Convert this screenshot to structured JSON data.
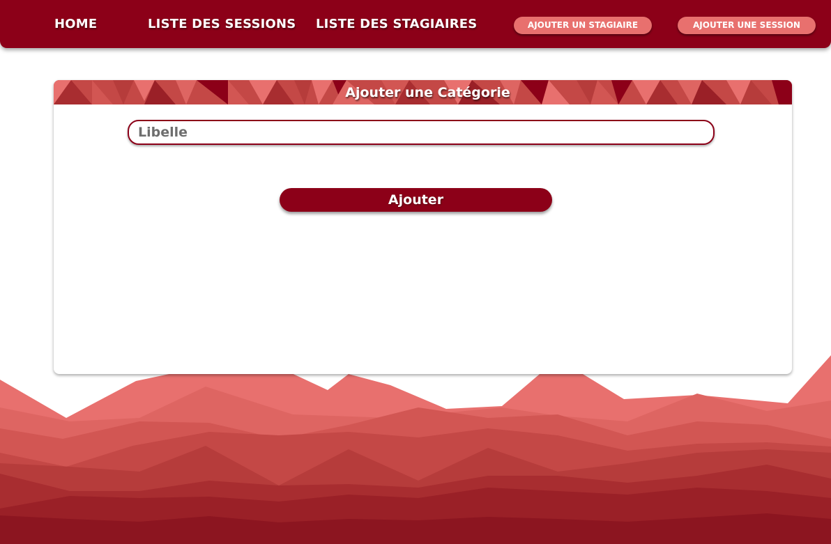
{
  "navbar": {
    "links": {
      "home": "HOME",
      "sessions": "LISTE DES SESSIONS",
      "stagiaires": "LISTE DES STAGIAIRES"
    },
    "buttons": {
      "add_stagiaire": "AJOUTER UN STAGIAIRE",
      "add_session": "AJOUTER UNE SESSION"
    }
  },
  "form": {
    "title": "Ajouter une Catégorie",
    "libelle_placeholder": "Libelle",
    "libelle_value": "",
    "submit_label": "Ajouter"
  },
  "colors": {
    "primary": "#8c0018",
    "accent": "#e8706e",
    "background": "#ffffff"
  }
}
